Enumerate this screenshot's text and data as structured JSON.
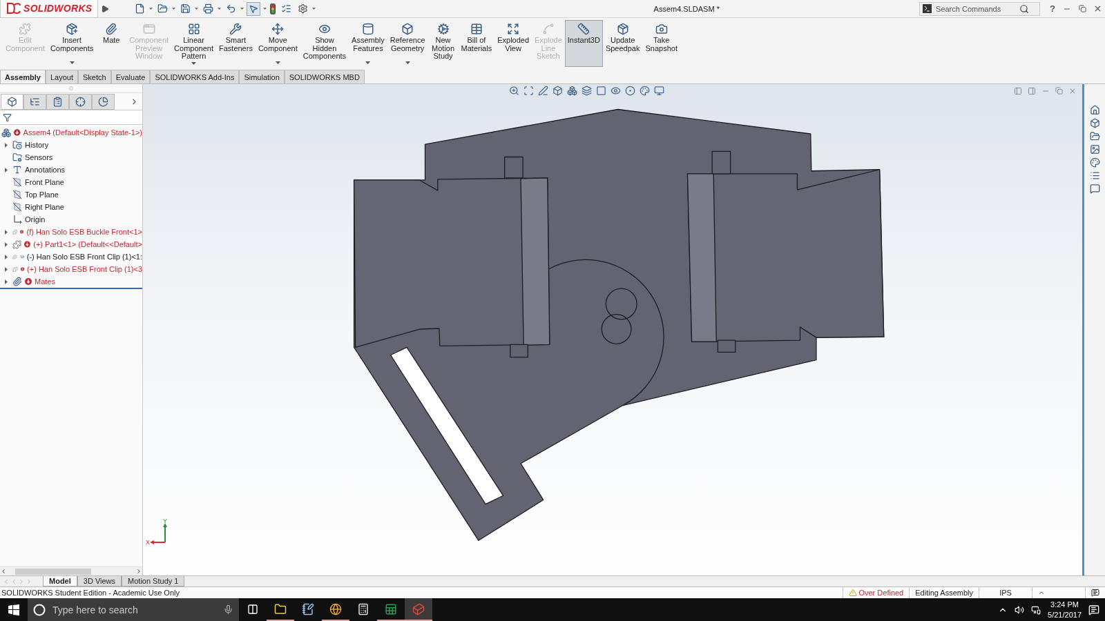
{
  "title_bar": {
    "logo": "SOLIDWORKS",
    "document_title": "Assem4.SLDASM *",
    "search": {
      "placeholder": "Search Commands"
    },
    "help": "?"
  },
  "ribbon": [
    {
      "label": "Edit Component",
      "disabled": true,
      "dropdown": false,
      "selected": false
    },
    {
      "label": "Insert Components",
      "disabled": false,
      "dropdown": true,
      "selected": false
    },
    {
      "label": "Mate",
      "disabled": false,
      "dropdown": false,
      "selected": false
    },
    {
      "label": "Component Preview Window",
      "disabled": true,
      "dropdown": false,
      "selected": false
    },
    {
      "label": "Linear Component Pattern",
      "disabled": false,
      "dropdown": true,
      "selected": false
    },
    {
      "label": "Smart Fasteners",
      "disabled": false,
      "dropdown": false,
      "selected": false
    },
    {
      "label": "Move Component",
      "disabled": false,
      "dropdown": true,
      "selected": false
    },
    {
      "label": "Show Hidden Components",
      "disabled": false,
      "dropdown": false,
      "selected": false
    },
    {
      "label": "Assembly Features",
      "disabled": false,
      "dropdown": true,
      "selected": false
    },
    {
      "label": "Reference Geometry",
      "disabled": false,
      "dropdown": true,
      "selected": false
    },
    {
      "label": "New Motion Study",
      "disabled": false,
      "dropdown": false,
      "selected": false
    },
    {
      "label": "Bill of Materials",
      "disabled": false,
      "dropdown": false,
      "selected": false
    },
    {
      "label": "Exploded View",
      "disabled": false,
      "dropdown": false,
      "selected": false
    },
    {
      "label": "Explode Line Sketch",
      "disabled": true,
      "dropdown": false,
      "selected": false
    },
    {
      "label": "Instant3D",
      "disabled": false,
      "dropdown": false,
      "selected": true
    },
    {
      "label": "Update Speedpak",
      "disabled": false,
      "dropdown": false,
      "selected": false
    },
    {
      "label": "Take Snapshot",
      "disabled": false,
      "dropdown": false,
      "selected": false
    }
  ],
  "command_tabs": [
    {
      "label": "Assembly",
      "selected": true
    },
    {
      "label": "Layout",
      "selected": false
    },
    {
      "label": "Sketch",
      "selected": false
    },
    {
      "label": "Evaluate",
      "selected": false
    },
    {
      "label": "SOLIDWORKS Add-Ins",
      "selected": false
    },
    {
      "label": "Simulation",
      "selected": false
    },
    {
      "label": "SOLIDWORKS MBD",
      "selected": false
    }
  ],
  "feature_manager": {
    "panel_tabs": [
      {
        "selected": true
      },
      {
        "selected": false
      },
      {
        "selected": false
      },
      {
        "selected": false
      },
      {
        "selected": false
      }
    ],
    "tree": [
      {
        "label": "Assem4  (Default<Display State-1>)",
        "kind": "assembly",
        "error": true,
        "student": false,
        "expandable": false
      },
      {
        "label": "History",
        "kind": "history",
        "error": false,
        "student": false,
        "expandable": true
      },
      {
        "label": "Sensors",
        "kind": "sensors",
        "error": false,
        "student": false,
        "expandable": false
      },
      {
        "label": "Annotations",
        "kind": "annotations",
        "error": false,
        "student": false,
        "expandable": true
      },
      {
        "label": "Front Plane",
        "kind": "plane",
        "error": false,
        "student": false,
        "expandable": false
      },
      {
        "label": "Top Plane",
        "kind": "plane",
        "error": false,
        "student": false,
        "expandable": false
      },
      {
        "label": "Right Plane",
        "kind": "plane",
        "error": false,
        "student": false,
        "expandable": false
      },
      {
        "label": "Origin",
        "kind": "origin",
        "error": false,
        "student": false,
        "expandable": false
      },
      {
        "label": "(f) Han Solo ESB Buckle Front<1>",
        "kind": "part",
        "error": true,
        "student": false,
        "expandable": true
      },
      {
        "label": "(+) Part1<1> (Default<<Default>",
        "kind": "part",
        "error": true,
        "student": false,
        "expandable": true
      },
      {
        "label": "(-) Han Solo ESB Front Clip (1)<1:",
        "kind": "part",
        "error": false,
        "student": true,
        "expandable": true
      },
      {
        "label": "(+) Han Solo ESB Front Clip (1)<3",
        "kind": "part",
        "error": true,
        "student": false,
        "expandable": true
      },
      {
        "label": "Mates",
        "kind": "mates",
        "error": true,
        "student": false,
        "expandable": true
      }
    ]
  },
  "viewport": {
    "triad": {
      "x": "X",
      "y": "Y"
    }
  },
  "bottom_tabs": [
    {
      "label": "Model",
      "selected": true
    },
    {
      "label": "3D Views",
      "selected": false
    },
    {
      "label": "Motion Study 1",
      "selected": false
    }
  ],
  "status_bar": {
    "edition": "SOLIDWORKS Student Edition - Academic Use Only",
    "rebuild_state": "Over Defined",
    "mode": "Editing Assembly",
    "units": "IPS"
  },
  "taskbar": {
    "search": {
      "placeholder": "Type here to search"
    },
    "apps": [
      {
        "kind": "file-explorer",
        "running": true,
        "active": false
      },
      {
        "kind": "notes",
        "running": false,
        "active": false
      },
      {
        "kind": "browser",
        "running": true,
        "active": false
      },
      {
        "kind": "calculator",
        "running": false,
        "active": false
      },
      {
        "kind": "spreadsheet",
        "running": true,
        "active": false
      },
      {
        "kind": "cad",
        "running": true,
        "active": true
      }
    ],
    "time": "3:24 PM",
    "date": "5/21/2017"
  }
}
